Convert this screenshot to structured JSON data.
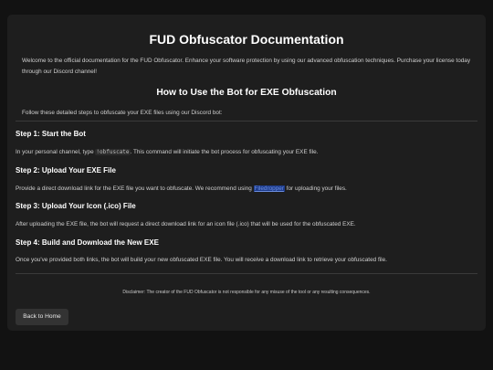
{
  "header": {
    "title": "FUD Obfuscator Documentation",
    "intro": "Welcome to the official documentation for the FUD Obfuscator. Enhance your software protection by using our advanced obfuscation techniques. Purchase your license today through our Discord channel!"
  },
  "guide": {
    "subtitle": "How to Use the Bot for EXE Obfuscation",
    "lead": "Follow these detailed steps to obfuscate your EXE files using our Discord bot:"
  },
  "steps": [
    {
      "title": "Step 1: Start the Bot",
      "text_before": "In your personal channel, type ",
      "code": "!obfuscate",
      "text_after": ". This command will initiate the bot process for obfuscating your EXE file."
    },
    {
      "title": "Step 2: Upload Your EXE File",
      "text_before": "Provide a direct download link for the EXE file you want to obfuscate. We recommend using ",
      "link": "Filedropper",
      "text_after": " for uploading your files."
    },
    {
      "title": "Step 3: Upload Your Icon (.ico) File",
      "text": "After uploading the EXE file, the bot will request a direct download link for an icon file (.ico) that will be used for the obfuscated EXE."
    },
    {
      "title": "Step 4: Build and Download the New EXE",
      "text": "Once you've provided both links, the bot will build your new obfuscated EXE file. You will receive a download link to retrieve your obfuscated file."
    }
  ],
  "footer": {
    "disclaimer": "Disclaimer: The creator of the FUD Obfuscator is not responsible for any misuse of the tool or any resulting consequences.",
    "back_label": "Back to Home"
  }
}
